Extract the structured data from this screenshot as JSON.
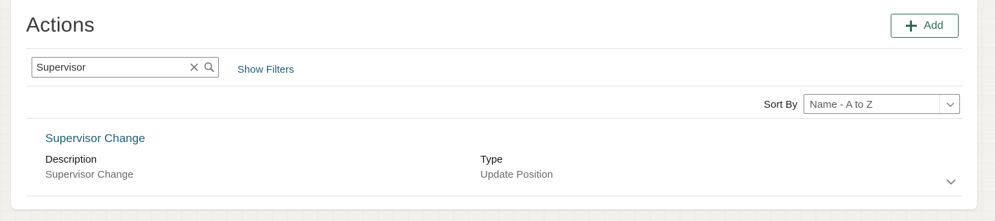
{
  "page": {
    "title": "Actions"
  },
  "toolbar": {
    "add_label": "Add"
  },
  "search": {
    "value": "Supervisor",
    "show_filters_label": "Show Filters"
  },
  "sort": {
    "label": "Sort By",
    "selected": "Name - A to Z"
  },
  "results": [
    {
      "title": "Supervisor Change",
      "description_label": "Description",
      "description_value": "Supervisor Change",
      "type_label": "Type",
      "type_value": "Update Position"
    }
  ],
  "icons": {
    "add": "plus-icon",
    "clear": "close-icon",
    "search": "search-icon",
    "sort": "chevron-down-icon",
    "expand": "chevron-down-icon"
  },
  "colors": {
    "accent": "#2f6b55",
    "link": "#1f5f77"
  }
}
